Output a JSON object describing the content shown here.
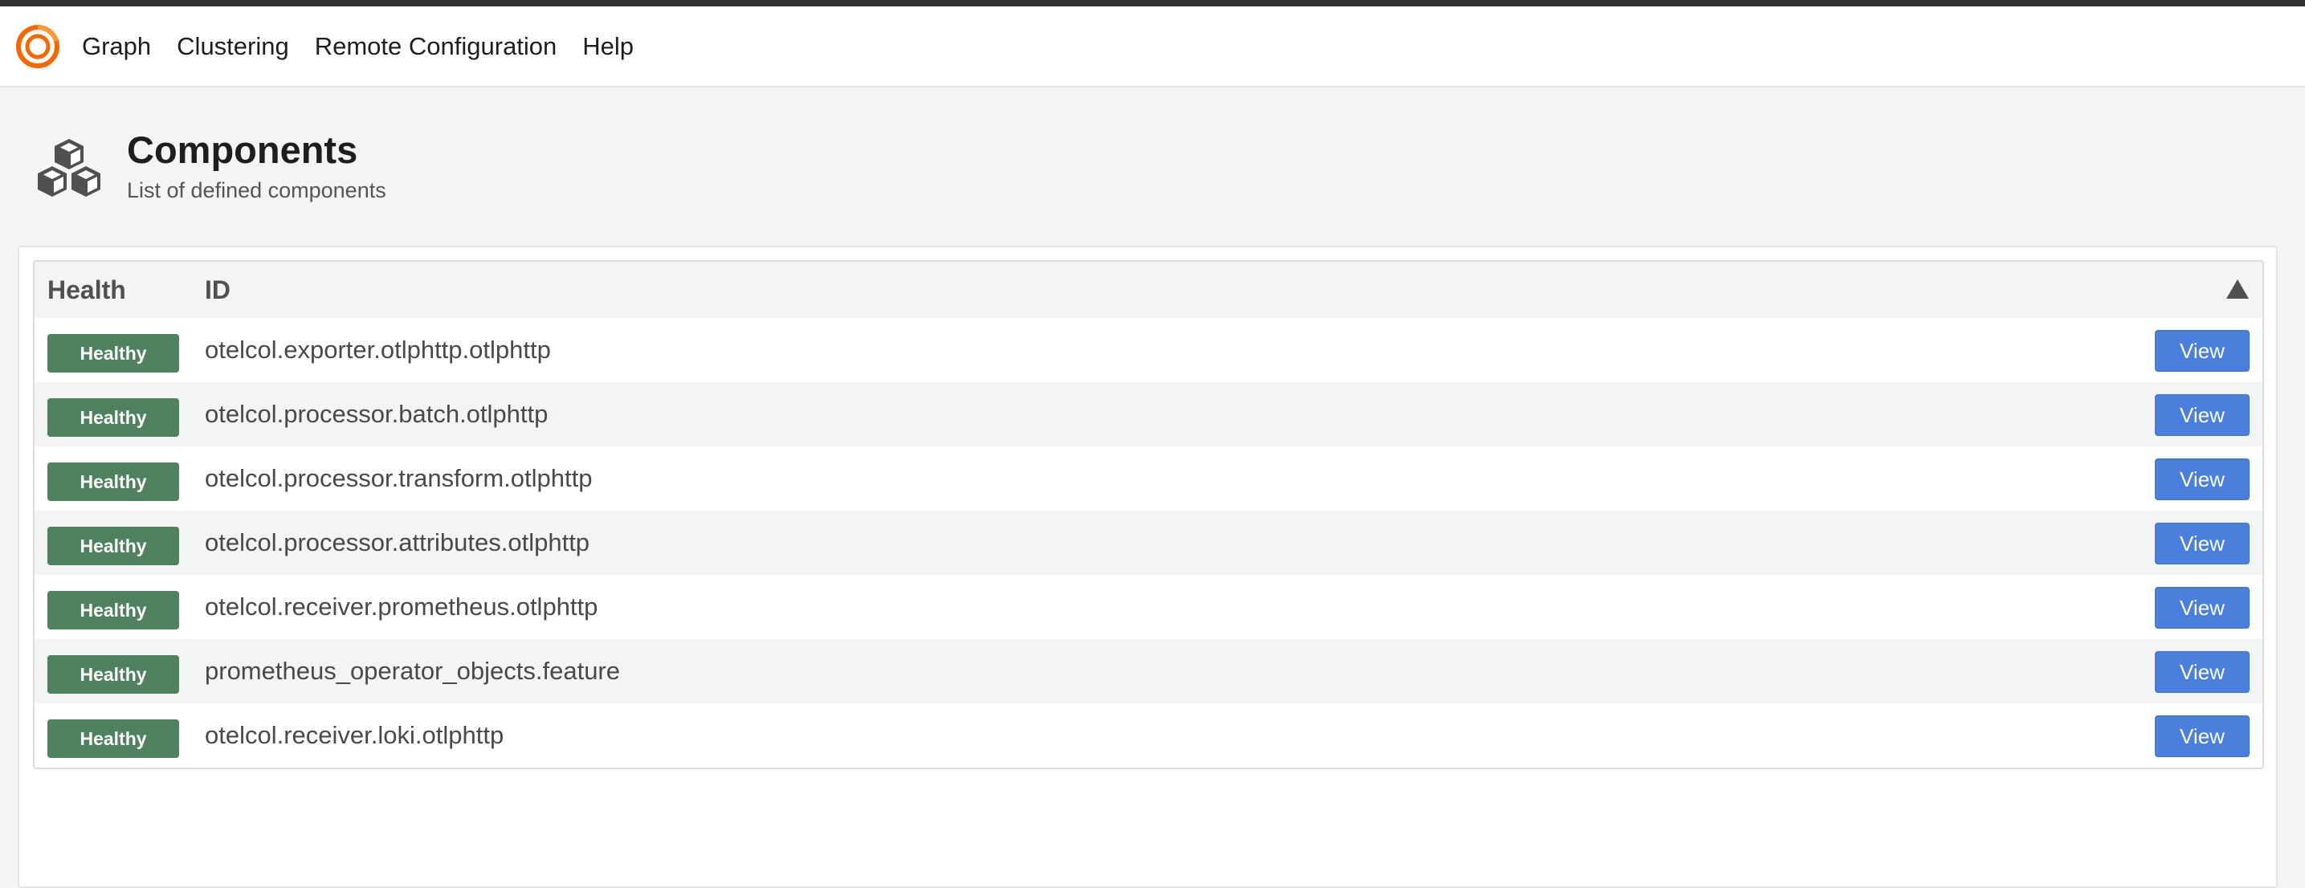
{
  "nav": {
    "items": [
      {
        "label": "Graph"
      },
      {
        "label": "Clustering"
      },
      {
        "label": "Remote Configuration"
      },
      {
        "label": "Help"
      }
    ]
  },
  "header": {
    "title": "Components",
    "subtitle": "List of defined components",
    "icon": "cubes-icon"
  },
  "table": {
    "columns": {
      "health": "Health",
      "id": "ID"
    },
    "sort_icon": "sort-up-triangle-icon",
    "rows": [
      {
        "health": "Healthy",
        "id": "otelcol.exporter.otlphttp.otlphttp",
        "action": "View"
      },
      {
        "health": "Healthy",
        "id": "otelcol.processor.batch.otlphttp",
        "action": "View"
      },
      {
        "health": "Healthy",
        "id": "otelcol.processor.transform.otlphttp",
        "action": "View"
      },
      {
        "health": "Healthy",
        "id": "otelcol.processor.attributes.otlphttp",
        "action": "View"
      },
      {
        "health": "Healthy",
        "id": "otelcol.receiver.prometheus.otlphttp",
        "action": "View"
      },
      {
        "health": "Healthy",
        "id": "prometheus_operator_objects.feature",
        "action": "View"
      },
      {
        "health": "Healthy",
        "id": "otelcol.receiver.loki.otlphttp",
        "action": "View"
      }
    ]
  },
  "colors": {
    "healthy_badge": "#4f8060",
    "view_button": "#4a80dc",
    "logo": "#f46800"
  }
}
